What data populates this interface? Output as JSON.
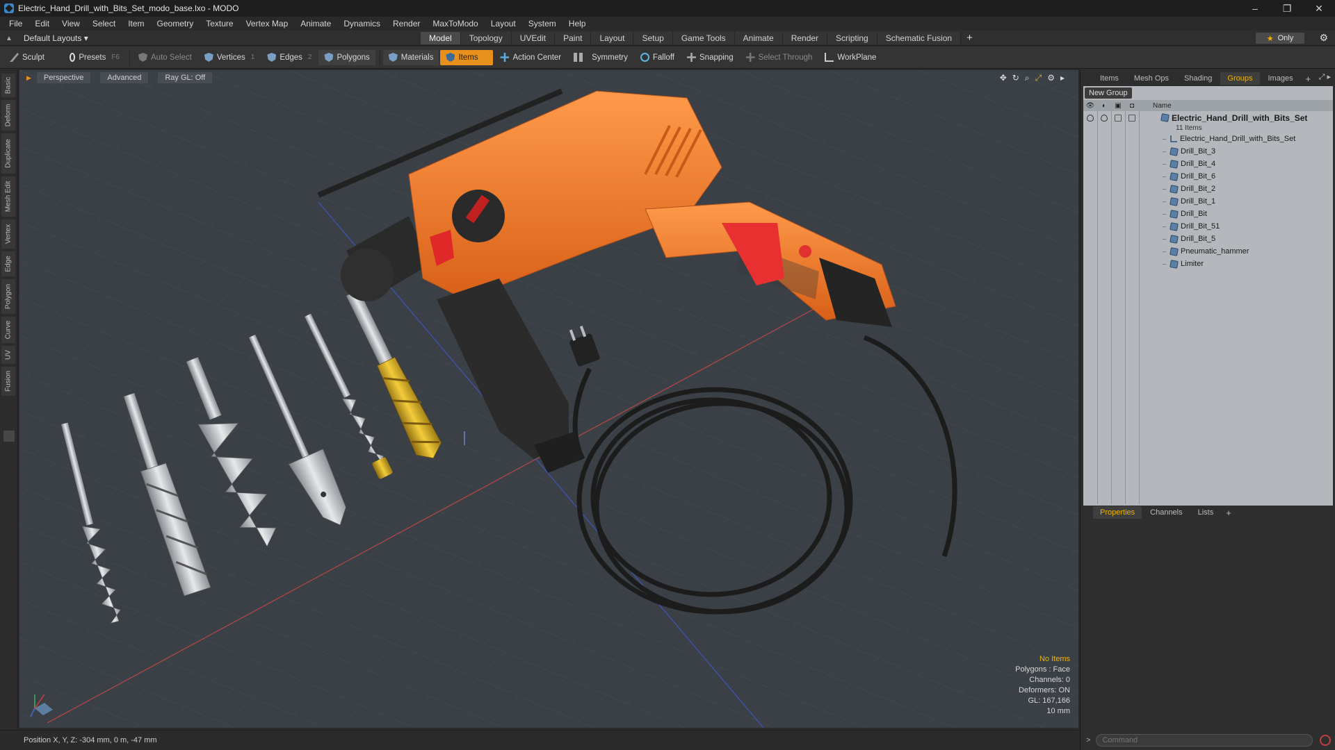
{
  "window": {
    "title": "Electric_Hand_Drill_with_Bits_Set_modo_base.lxo - MODO",
    "controls": [
      "–",
      "❐",
      "✕"
    ]
  },
  "menu": [
    "File",
    "Edit",
    "View",
    "Select",
    "Item",
    "Geometry",
    "Texture",
    "Vertex Map",
    "Animate",
    "Dynamics",
    "Render",
    "MaxToModo",
    "Layout",
    "System",
    "Help"
  ],
  "layout": {
    "selector": "Default Layouts ▾",
    "tabs": [
      "Model",
      "Topology",
      "UVEdit",
      "Paint",
      "Layout",
      "Setup",
      "Game Tools",
      "Animate",
      "Render",
      "Scripting",
      "Schematic Fusion"
    ],
    "active_tab": "Model",
    "add_tab": "+",
    "only_label": "Only"
  },
  "toolbar": {
    "sculpt": "Sculpt",
    "presets": "Presets",
    "presets_key": "F6",
    "auto_select": "Auto Select",
    "vertices": "Vertices",
    "vertices_count": "1",
    "edges": "Edges",
    "edges_count": "2",
    "polygons": "Polygons",
    "materials": "Materials",
    "items": "Items",
    "action_center": "Action Center",
    "symmetry": "Symmetry",
    "falloff": "Falloff",
    "snapping": "Snapping",
    "select_through": "Select Through",
    "workplane": "WorkPlane"
  },
  "left_tabs": [
    "Basic",
    "Deform",
    "Duplicate",
    "Mesh Edit",
    "Vertex",
    "Edge",
    "Polygon",
    "Curve",
    "UV",
    "Fusion"
  ],
  "viewport": {
    "view": "Perspective",
    "shading": "Advanced",
    "raygl": "Ray GL: Off",
    "hud": {
      "selection": "No Items",
      "polygons": "Polygons : Face",
      "channels": "Channels: 0",
      "deformers": "Deformers: ON",
      "gl": "GL: 167,166",
      "scale": "10 mm"
    }
  },
  "status": {
    "position": "Position X, Y, Z:  -304 mm, 0 m, -47 mm"
  },
  "right_panel": {
    "tabs": [
      "Items",
      "Mesh Ops",
      "Shading",
      "Groups",
      "Images"
    ],
    "active_tab": "Groups",
    "new_group": "New Group",
    "name_header": "Name",
    "group": {
      "name": "Electric_Hand_Drill_with_Bits_Set",
      "count": "11 Items",
      "items": [
        "Electric_Hand_Drill_with_Bits_Set",
        "Drill_Bit_3",
        "Drill_Bit_4",
        "Drill_Bit_6",
        "Drill_Bit_2",
        "Drill_Bit_1",
        "Drill_Bit",
        "Drill_Bit_51",
        "Drill_Bit_5",
        "Pneumatic_hammer",
        "Limiter"
      ]
    },
    "bottom_tabs": [
      "Properties",
      "Channels",
      "Lists"
    ],
    "bottom_active": "Properties",
    "command_placeholder": "Command"
  },
  "colors": {
    "accent": "#e8901c",
    "drill_body": "#f07a2a",
    "viewport_bg": "#3a4046",
    "panel_bg": "#b4b8bc",
    "highlight": "#f0b400"
  }
}
